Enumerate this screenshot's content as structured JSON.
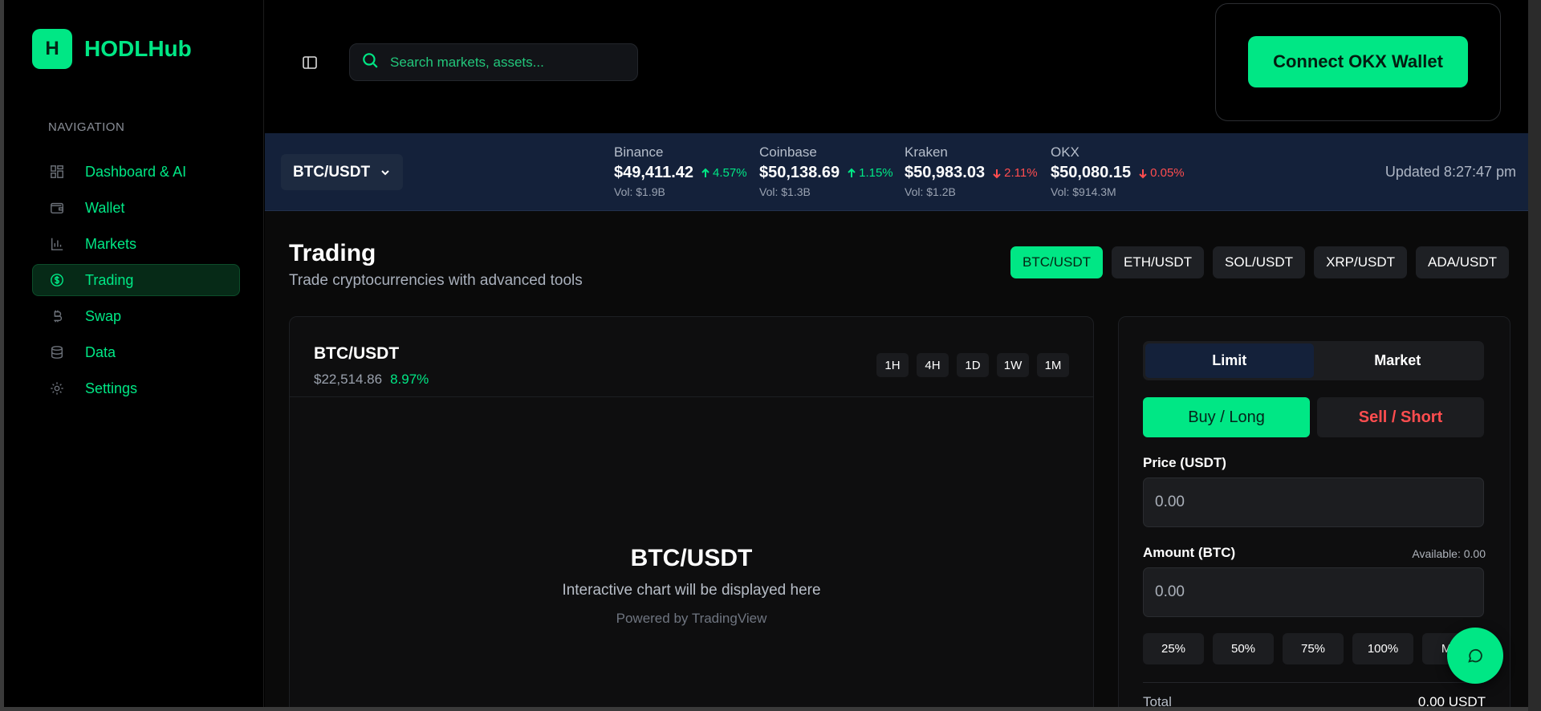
{
  "brand": {
    "logo_letter": "H",
    "name": "HODLHub",
    "accent": "#00e785"
  },
  "sidebar": {
    "heading": "NAVIGATION",
    "items": [
      {
        "label": "Dashboard & AI",
        "icon": "dashboard-icon"
      },
      {
        "label": "Wallet",
        "icon": "wallet-icon"
      },
      {
        "label": "Markets",
        "icon": "bar-chart-icon"
      },
      {
        "label": "Trading",
        "icon": "dollar-circle-icon",
        "active": true
      },
      {
        "label": "Swap",
        "icon": "bitcoin-icon"
      },
      {
        "label": "Data",
        "icon": "database-icon"
      },
      {
        "label": "Settings",
        "icon": "gear-icon"
      }
    ]
  },
  "header": {
    "search_placeholder": "Search markets, assets...",
    "wallet_button": "Connect OKX Wallet"
  },
  "ticker": {
    "selected_pair": "BTC/USDT",
    "exchanges": [
      {
        "name": "Binance",
        "price": "$49,411.42",
        "change": "4.57%",
        "direction": "up",
        "volume": "Vol: $1.9B"
      },
      {
        "name": "Coinbase",
        "price": "$50,138.69",
        "change": "1.15%",
        "direction": "up",
        "volume": "Vol: $1.3B"
      },
      {
        "name": "Kraken",
        "price": "$50,983.03",
        "change": "2.11%",
        "direction": "down",
        "volume": "Vol: $1.2B"
      },
      {
        "name": "OKX",
        "price": "$50,080.15",
        "change": "0.05%",
        "direction": "down",
        "volume": "Vol: $914.3M"
      }
    ],
    "updated": "Updated 8:27:47 pm"
  },
  "page": {
    "title": "Trading",
    "subtitle": "Trade cryptocurrencies with advanced tools",
    "pair_tabs": [
      "BTC/USDT",
      "ETH/USDT",
      "SOL/USDT",
      "XRP/USDT",
      "ADA/USDT"
    ]
  },
  "chart": {
    "pair": "BTC/USDT",
    "price": "$22,514.86",
    "change": "8.97%",
    "intervals": [
      "1H",
      "4H",
      "1D",
      "1W",
      "1M"
    ],
    "placeholder_title": "BTC/USDT",
    "placeholder_desc": "Interactive chart will be displayed here",
    "powered_by": "Powered by TradingView"
  },
  "order": {
    "type_limit": "Limit",
    "type_market": "Market",
    "buy": "Buy / Long",
    "sell": "Sell / Short",
    "price_label": "Price (USDT)",
    "price_placeholder": "0.00",
    "amount_label": "Amount (BTC)",
    "available": "Available: 0.00",
    "amount_placeholder": "0.00",
    "percents": [
      "25%",
      "50%",
      "75%",
      "100%",
      "Max"
    ],
    "total_label": "Total",
    "total_value": "0.00 USDT"
  }
}
